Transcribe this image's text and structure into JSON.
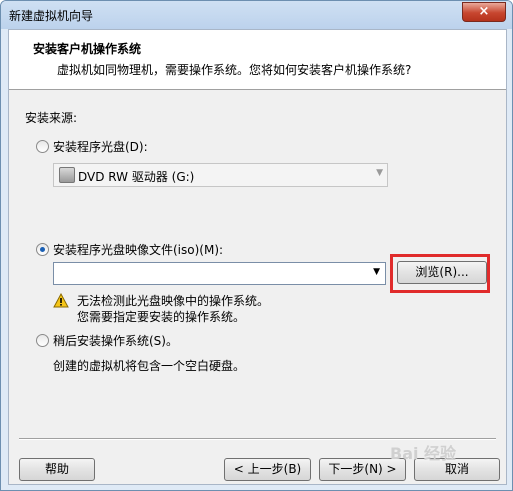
{
  "window": {
    "title": "新建虚拟机向导",
    "close_label": "×"
  },
  "header": {
    "title": "安装客户机操作系统",
    "subtitle": "虚拟机如同物理机，需要操作系统。您将如何安装客户机操作系统?"
  },
  "source": {
    "label": "安装来源:",
    "disc_option": "安装程序光盘(D):",
    "disc_selected": "DVD RW 驱动器 (G:)",
    "iso_option": "安装程序光盘映像文件(iso)(M):",
    "iso_value": "",
    "browse_label": "浏览(R)...",
    "warning_line1": "无法检测此光盘映像中的操作系统。",
    "warning_line2": "您需要指定要安装的操作系统。",
    "later_option": "稍后安装操作系统(S)。",
    "later_desc": "创建的虚拟机将包含一个空白硬盘。",
    "selected": "iso"
  },
  "footer": {
    "help_label": "帮助",
    "back_label": "< 上一步(B)",
    "next_label": "下一步(N) >",
    "cancel_label": "取消"
  },
  "watermark": "Bai 经验"
}
